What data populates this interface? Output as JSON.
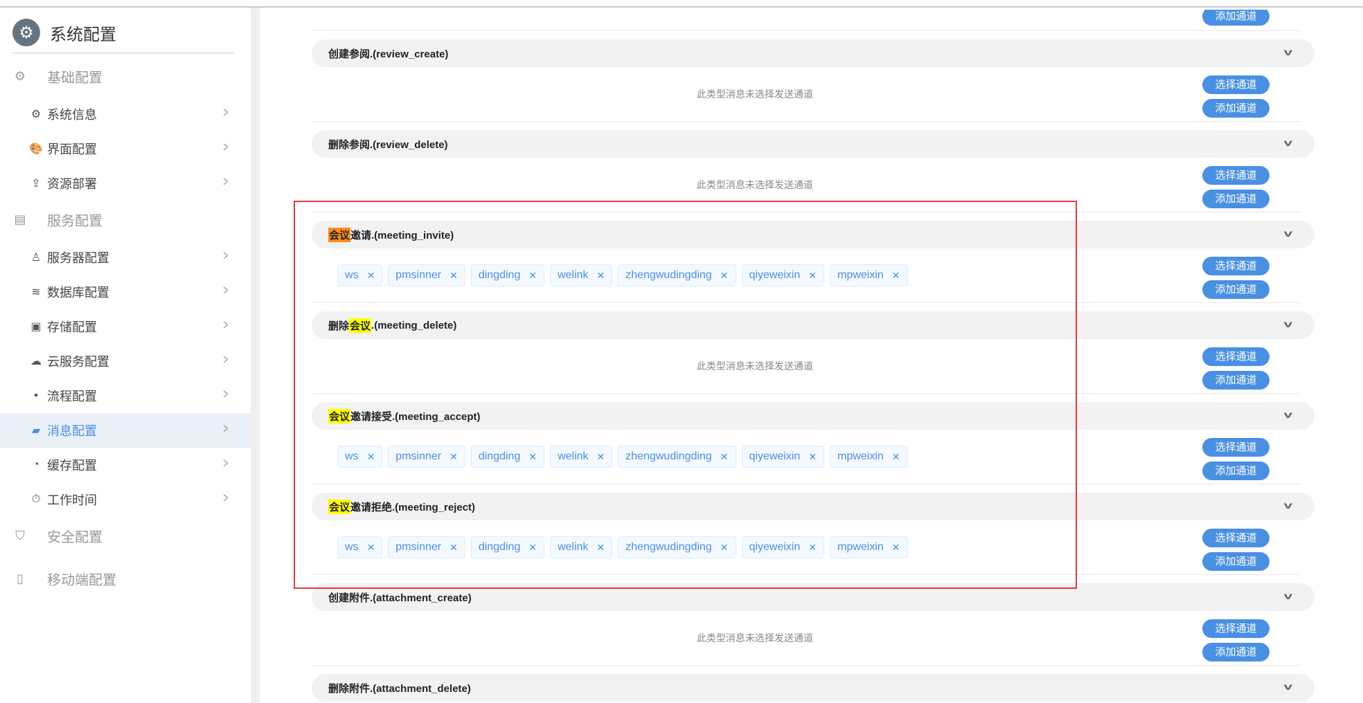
{
  "sidebar": {
    "title": "系统配置",
    "groups": [
      {
        "label": "基础配置",
        "icon": "gear-icon",
        "items": [
          {
            "label": "系统信息",
            "icon": "gear-icon"
          },
          {
            "label": "界面配置",
            "icon": "palette-icon"
          },
          {
            "label": "资源部署",
            "icon": "upload-icon"
          }
        ]
      },
      {
        "label": "服务配置",
        "icon": "server-icon",
        "items": [
          {
            "label": "服务器配置",
            "icon": "user-hand-icon"
          },
          {
            "label": "数据库配置",
            "icon": "database-icon"
          },
          {
            "label": "存储配置",
            "icon": "archive-icon"
          },
          {
            "label": "云服务配置",
            "icon": "cloud-icon"
          },
          {
            "label": "流程配置",
            "icon": "flow-icon"
          },
          {
            "label": "消息配置",
            "icon": "message-gear-icon",
            "active": true
          },
          {
            "label": "缓存配置",
            "icon": "pie-icon"
          },
          {
            "label": "工作时间",
            "icon": "stopwatch-icon"
          }
        ]
      },
      {
        "label": "安全配置",
        "icon": "shield-icon",
        "items": []
      },
      {
        "label": "移动端配置",
        "icon": "mobile-icon",
        "items": []
      }
    ]
  },
  "labels": {
    "select": "选择通道",
    "add": "添加通道",
    "empty": "此类型消息未选择发送通道"
  },
  "colors": {
    "accent": "#4a90e2",
    "highlight_orange": "#ff8c1a",
    "highlight_yellow": "#ffff00",
    "annotation": "#e53935"
  },
  "sections": [
    {
      "pre": "创建参阅.(review_create)",
      "hl": "",
      "post": "",
      "channels": []
    },
    {
      "pre": "删除参阅.(review_delete)",
      "hl": "",
      "post": "",
      "channels": []
    },
    {
      "pre": "",
      "hl": "会议",
      "hl_color": "#ff8c1a",
      "post": "邀请.(meeting_invite)",
      "channels": [
        "ws",
        "pmsinner",
        "dingding",
        "welink",
        "zhengwudingding",
        "qiyeweixin",
        "mpweixin"
      ]
    },
    {
      "pre": "删除",
      "hl": "会议",
      "hl_color": "#ffff00",
      "post": ".(meeting_delete)",
      "channels": []
    },
    {
      "pre": "",
      "hl": "会议",
      "hl_color": "#ffff00",
      "post": "邀请接受.(meeting_accept)",
      "channels": [
        "ws",
        "pmsinner",
        "dingding",
        "welink",
        "zhengwudingding",
        "qiyeweixin",
        "mpweixin"
      ]
    },
    {
      "pre": "",
      "hl": "会议",
      "hl_color": "#ffff00",
      "post": "邀请拒绝.(meeting_reject)",
      "channels": [
        "ws",
        "pmsinner",
        "dingding",
        "welink",
        "zhengwudingding",
        "qiyeweixin",
        "mpweixin"
      ]
    },
    {
      "pre": "创建附件.(attachment_create)",
      "hl": "",
      "post": "",
      "channels": []
    },
    {
      "pre": "删除附件.(attachment_delete)",
      "hl": "",
      "post": "",
      "channels": []
    }
  ]
}
